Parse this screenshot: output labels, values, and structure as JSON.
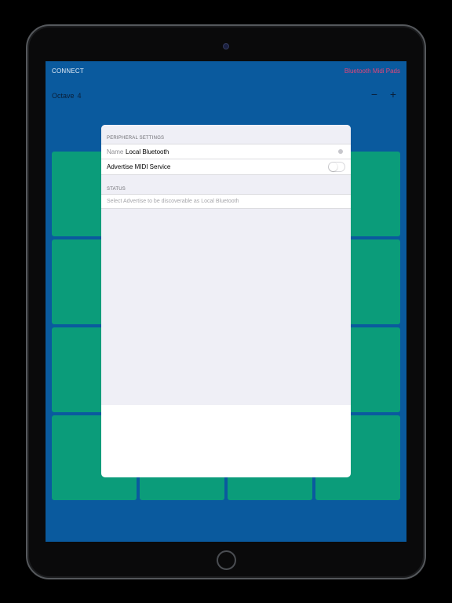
{
  "toolbar": {
    "connect_label": "CONNECT",
    "app_title": "Bluetooth Midi Pads"
  },
  "octave": {
    "label": "Octave",
    "value": "4",
    "decrement": "−",
    "increment": "+"
  },
  "colors": {
    "background": "#0a5a9e",
    "pad": "#0b9c7a",
    "title_accent": "#e0457a"
  },
  "modal": {
    "peripheral_header": "PERIPHERAL SETTINGS",
    "name_label": "Name",
    "name_value": "Local Bluetooth",
    "advertise_label": "Advertise MIDI Service",
    "advertise_enabled": false,
    "status_header": "STATUS",
    "status_text": "Select Advertise to be discoverable as Local Bluetooth"
  },
  "icons": {
    "clear": "clear-icon",
    "toggle": "switch-icon"
  }
}
